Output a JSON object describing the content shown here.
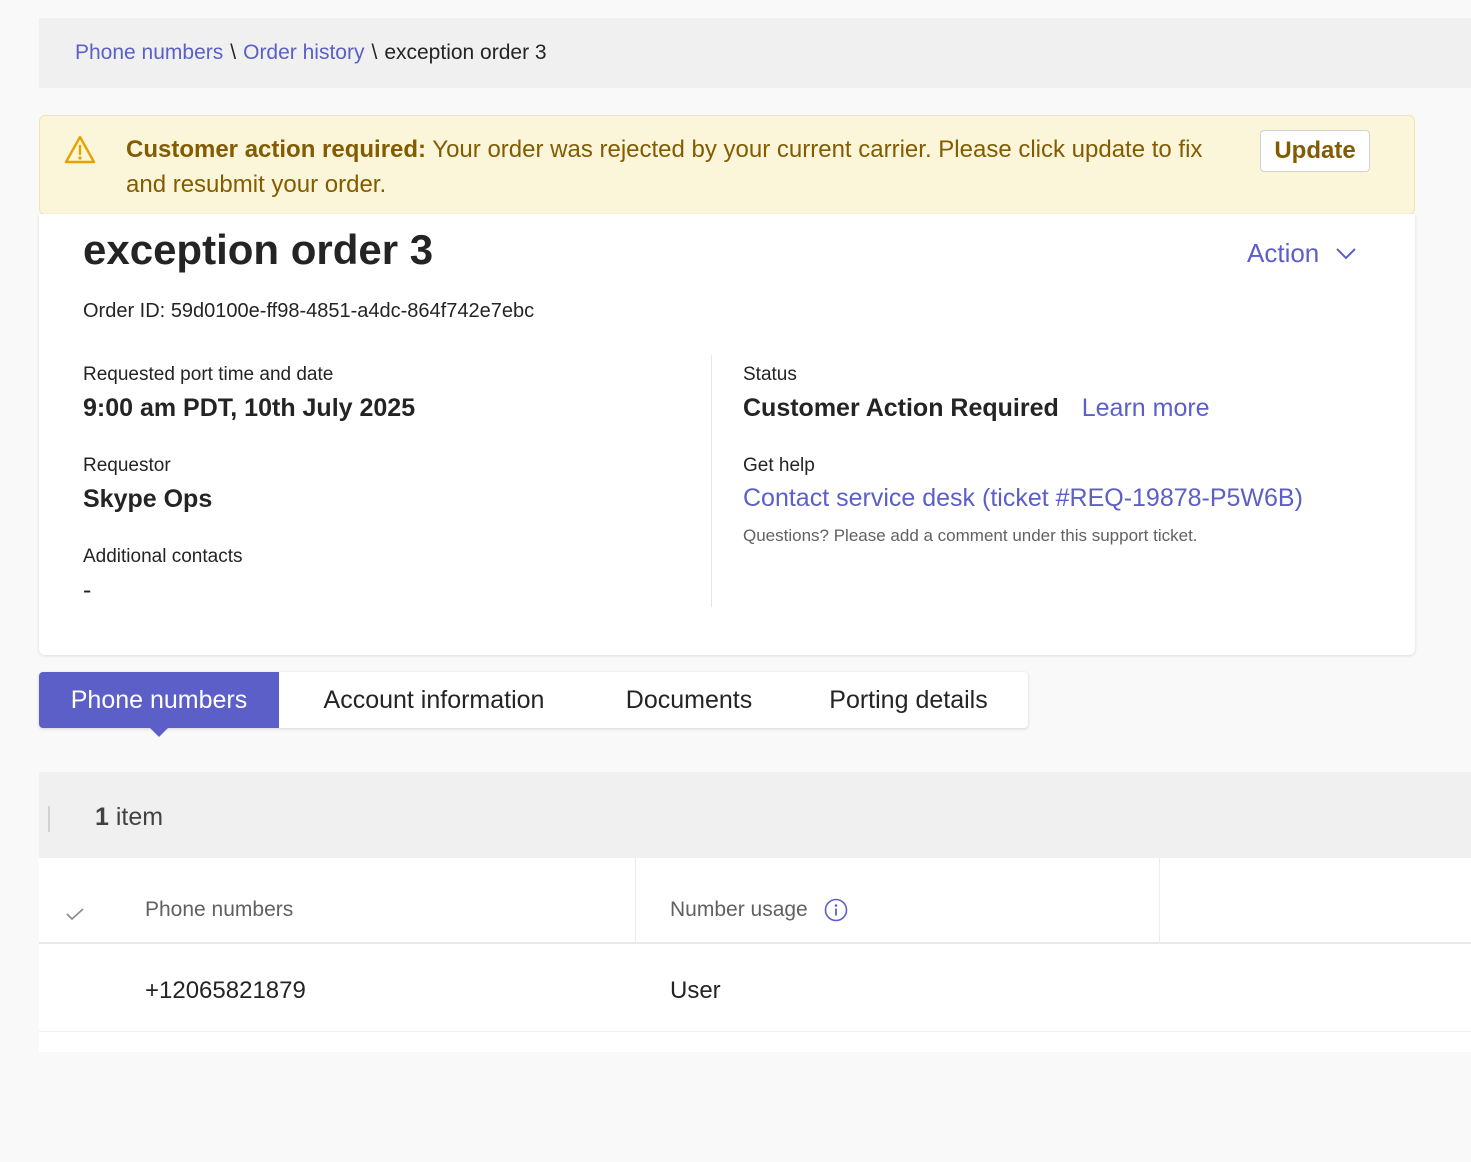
{
  "breadcrumb": {
    "items": [
      "Phone numbers",
      "Order history"
    ],
    "separator": "\\",
    "current": "exception order 3"
  },
  "banner": {
    "title": "Customer action required:",
    "message": " Your order was rejected by your current carrier. Please click update to fix and resubmit your order.",
    "button_label": "Update",
    "icon": "warning-icon"
  },
  "order": {
    "title": "exception order 3",
    "action_label": "Action",
    "id_label": "Order ID:",
    "id_value": "59d0100e-ff98-4851-a4dc-864f742e7ebc",
    "port_time_label": "Requested port time and date",
    "port_time_value": "9:00 am PDT, 10th July 2025",
    "requestor_label": "Requestor",
    "requestor_value": "Skype Ops",
    "contacts_label": "Additional contacts",
    "contacts_value": "-",
    "status_label": "Status",
    "status_value": "Customer Action Required",
    "learn_more": "Learn more",
    "help_label": "Get help",
    "help_link": "Contact service desk (ticket #REQ-19878-P5W6B)",
    "help_note": "Questions? Please add a comment under this support ticket."
  },
  "tabs": [
    {
      "label": "Phone numbers",
      "active": true
    },
    {
      "label": "Account information",
      "active": false
    },
    {
      "label": "Documents",
      "active": false
    },
    {
      "label": "Porting details",
      "active": false
    }
  ],
  "list": {
    "count": "1",
    "count_suffix": " item",
    "columns": [
      "Phone numbers",
      "Number usage"
    ],
    "rows": [
      {
        "phone": "+12065821879",
        "usage": "User"
      }
    ]
  },
  "colors": {
    "accent": "#5b5fc7",
    "banner_bg": "#fbf6d9",
    "banner_text": "#835b00"
  }
}
